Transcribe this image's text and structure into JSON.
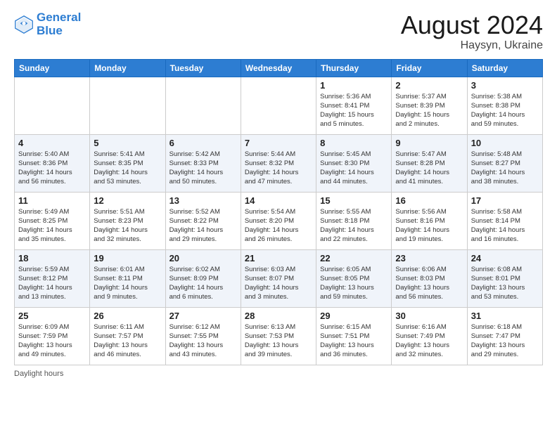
{
  "header": {
    "logo_line1": "General",
    "logo_line2": "Blue",
    "month": "August 2024",
    "location": "Haysyn, Ukraine"
  },
  "weekdays": [
    "Sunday",
    "Monday",
    "Tuesday",
    "Wednesday",
    "Thursday",
    "Friday",
    "Saturday"
  ],
  "weeks": [
    [
      {
        "day": "",
        "info": ""
      },
      {
        "day": "",
        "info": ""
      },
      {
        "day": "",
        "info": ""
      },
      {
        "day": "",
        "info": ""
      },
      {
        "day": "1",
        "info": "Sunrise: 5:36 AM\nSunset: 8:41 PM\nDaylight: 15 hours\nand 5 minutes."
      },
      {
        "day": "2",
        "info": "Sunrise: 5:37 AM\nSunset: 8:39 PM\nDaylight: 15 hours\nand 2 minutes."
      },
      {
        "day": "3",
        "info": "Sunrise: 5:38 AM\nSunset: 8:38 PM\nDaylight: 14 hours\nand 59 minutes."
      }
    ],
    [
      {
        "day": "4",
        "info": "Sunrise: 5:40 AM\nSunset: 8:36 PM\nDaylight: 14 hours\nand 56 minutes."
      },
      {
        "day": "5",
        "info": "Sunrise: 5:41 AM\nSunset: 8:35 PM\nDaylight: 14 hours\nand 53 minutes."
      },
      {
        "day": "6",
        "info": "Sunrise: 5:42 AM\nSunset: 8:33 PM\nDaylight: 14 hours\nand 50 minutes."
      },
      {
        "day": "7",
        "info": "Sunrise: 5:44 AM\nSunset: 8:32 PM\nDaylight: 14 hours\nand 47 minutes."
      },
      {
        "day": "8",
        "info": "Sunrise: 5:45 AM\nSunset: 8:30 PM\nDaylight: 14 hours\nand 44 minutes."
      },
      {
        "day": "9",
        "info": "Sunrise: 5:47 AM\nSunset: 8:28 PM\nDaylight: 14 hours\nand 41 minutes."
      },
      {
        "day": "10",
        "info": "Sunrise: 5:48 AM\nSunset: 8:27 PM\nDaylight: 14 hours\nand 38 minutes."
      }
    ],
    [
      {
        "day": "11",
        "info": "Sunrise: 5:49 AM\nSunset: 8:25 PM\nDaylight: 14 hours\nand 35 minutes."
      },
      {
        "day": "12",
        "info": "Sunrise: 5:51 AM\nSunset: 8:23 PM\nDaylight: 14 hours\nand 32 minutes."
      },
      {
        "day": "13",
        "info": "Sunrise: 5:52 AM\nSunset: 8:22 PM\nDaylight: 14 hours\nand 29 minutes."
      },
      {
        "day": "14",
        "info": "Sunrise: 5:54 AM\nSunset: 8:20 PM\nDaylight: 14 hours\nand 26 minutes."
      },
      {
        "day": "15",
        "info": "Sunrise: 5:55 AM\nSunset: 8:18 PM\nDaylight: 14 hours\nand 22 minutes."
      },
      {
        "day": "16",
        "info": "Sunrise: 5:56 AM\nSunset: 8:16 PM\nDaylight: 14 hours\nand 19 minutes."
      },
      {
        "day": "17",
        "info": "Sunrise: 5:58 AM\nSunset: 8:14 PM\nDaylight: 14 hours\nand 16 minutes."
      }
    ],
    [
      {
        "day": "18",
        "info": "Sunrise: 5:59 AM\nSunset: 8:12 PM\nDaylight: 14 hours\nand 13 minutes."
      },
      {
        "day": "19",
        "info": "Sunrise: 6:01 AM\nSunset: 8:11 PM\nDaylight: 14 hours\nand 9 minutes."
      },
      {
        "day": "20",
        "info": "Sunrise: 6:02 AM\nSunset: 8:09 PM\nDaylight: 14 hours\nand 6 minutes."
      },
      {
        "day": "21",
        "info": "Sunrise: 6:03 AM\nSunset: 8:07 PM\nDaylight: 14 hours\nand 3 minutes."
      },
      {
        "day": "22",
        "info": "Sunrise: 6:05 AM\nSunset: 8:05 PM\nDaylight: 13 hours\nand 59 minutes."
      },
      {
        "day": "23",
        "info": "Sunrise: 6:06 AM\nSunset: 8:03 PM\nDaylight: 13 hours\nand 56 minutes."
      },
      {
        "day": "24",
        "info": "Sunrise: 6:08 AM\nSunset: 8:01 PM\nDaylight: 13 hours\nand 53 minutes."
      }
    ],
    [
      {
        "day": "25",
        "info": "Sunrise: 6:09 AM\nSunset: 7:59 PM\nDaylight: 13 hours\nand 49 minutes."
      },
      {
        "day": "26",
        "info": "Sunrise: 6:11 AM\nSunset: 7:57 PM\nDaylight: 13 hours\nand 46 minutes."
      },
      {
        "day": "27",
        "info": "Sunrise: 6:12 AM\nSunset: 7:55 PM\nDaylight: 13 hours\nand 43 minutes."
      },
      {
        "day": "28",
        "info": "Sunrise: 6:13 AM\nSunset: 7:53 PM\nDaylight: 13 hours\nand 39 minutes."
      },
      {
        "day": "29",
        "info": "Sunrise: 6:15 AM\nSunset: 7:51 PM\nDaylight: 13 hours\nand 36 minutes."
      },
      {
        "day": "30",
        "info": "Sunrise: 6:16 AM\nSunset: 7:49 PM\nDaylight: 13 hours\nand 32 minutes."
      },
      {
        "day": "31",
        "info": "Sunrise: 6:18 AM\nSunset: 7:47 PM\nDaylight: 13 hours\nand 29 minutes."
      }
    ]
  ],
  "footer": {
    "daylight_label": "Daylight hours"
  }
}
